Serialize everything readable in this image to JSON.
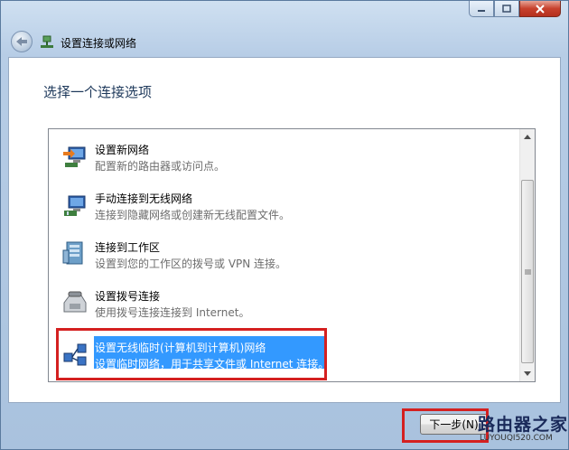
{
  "window": {
    "caption_buttons": {
      "minimize": "minimize-icon",
      "maximize": "maximize-icon",
      "close": "close-icon"
    },
    "nav_title": "设置连接或网络"
  },
  "main": {
    "heading": "选择一个连接选项",
    "options": [
      {
        "title": "设置新网络",
        "desc": "配置新的路由器或访问点。",
        "icon": "new-network-icon"
      },
      {
        "title": "手动连接到无线网络",
        "desc": "连接到隐藏网络或创建新无线配置文件。",
        "icon": "wireless-connect-icon"
      },
      {
        "title": "连接到工作区",
        "desc": "设置到您的工作区的拨号或 VPN 连接。",
        "icon": "workplace-icon"
      },
      {
        "title": "设置拨号连接",
        "desc": "使用拨号连接连接到 Internet。",
        "icon": "dialup-icon"
      },
      {
        "title": "设置无线临时(计算机到计算机)网络",
        "desc": "设置临时网络，用于共享文件或 Internet 连接。",
        "icon": "adhoc-network-icon"
      }
    ],
    "selected_index": 4
  },
  "footer": {
    "next_label": "下一步(N)"
  },
  "watermark": {
    "top": "路由器之家",
    "bottom": "LUYOUQI520.COM"
  },
  "colors": {
    "selection": "#3399ff",
    "highlight_box": "#d42020",
    "heading": "#1e395b"
  }
}
